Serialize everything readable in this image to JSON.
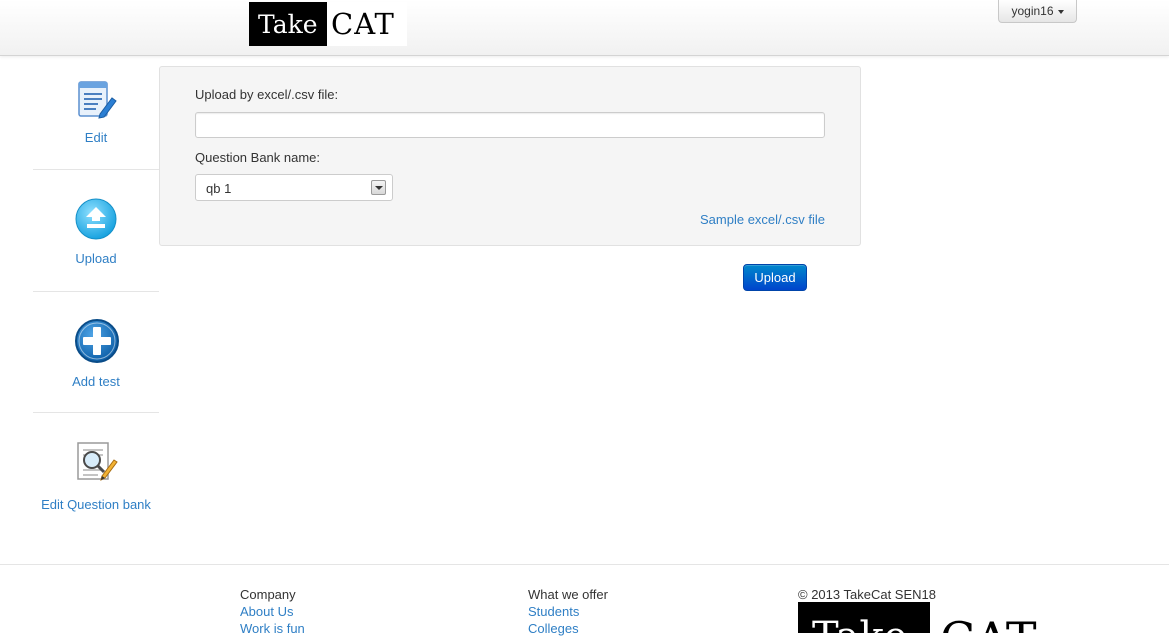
{
  "navbar": {
    "brand": {
      "take": "Take",
      "cat": "CAT"
    },
    "user_menu": {
      "label": "yogin16"
    }
  },
  "sidebar": {
    "items": [
      {
        "label": "Edit",
        "icon": "edit-document-icon"
      },
      {
        "label": "Upload",
        "icon": "upload-circle-icon"
      },
      {
        "label": "Add test",
        "icon": "add-circle-icon"
      },
      {
        "label": "Edit Question bank",
        "icon": "magnifier-document-icon"
      }
    ]
  },
  "upload_form": {
    "file_label": "Upload by excel/.csv file:",
    "file_value": "",
    "qb_label": "Question Bank name:",
    "qb_selected": "qb 1",
    "sample_link": "Sample excel/.csv file",
    "submit_label": "Upload"
  },
  "footer": {
    "company": {
      "heading": "Company",
      "links": [
        "About Us",
        "Work is fun"
      ]
    },
    "offer": {
      "heading": "What we offer",
      "links": [
        "Students",
        "Colleges"
      ]
    },
    "copyright": "© 2013 TakeCat SEN18",
    "logo": {
      "take": "Take",
      "cat": "CAT"
    }
  },
  "colors": {
    "link": "#2f7fc5",
    "primary_button": "#0055cc",
    "panel_bg": "#f5f5f5"
  }
}
